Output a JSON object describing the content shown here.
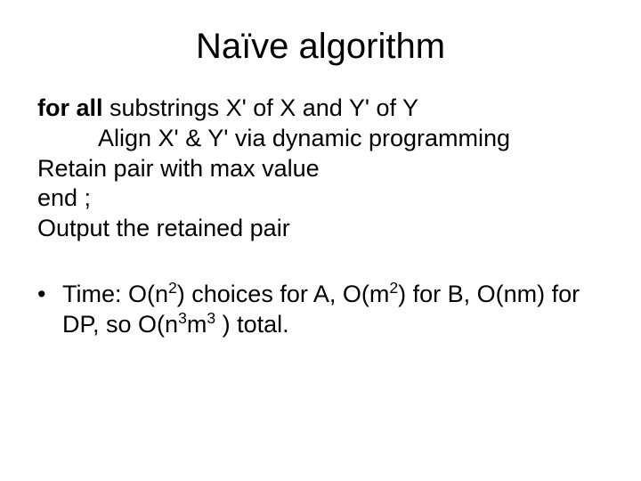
{
  "title": "Naïve algorithm",
  "algo": {
    "for_kw": "for all",
    "for_rest": " substrings X' of X and Y' of Y",
    "align": "Align X' & Y' via dynamic programming",
    "retain": "Retain pair with max value",
    "end": "end ;",
    "output": "Output the retained pair"
  },
  "bullet": {
    "dot": "•",
    "t1": "Time: O(n",
    "e1": "2",
    "t2": ") choices for A, O(m",
    "e2": "2",
    "t3": ") for B, O(nm) for DP, so O(n",
    "e3": "3",
    "t4": "m",
    "e4": "3",
    "t5": " ) total."
  }
}
